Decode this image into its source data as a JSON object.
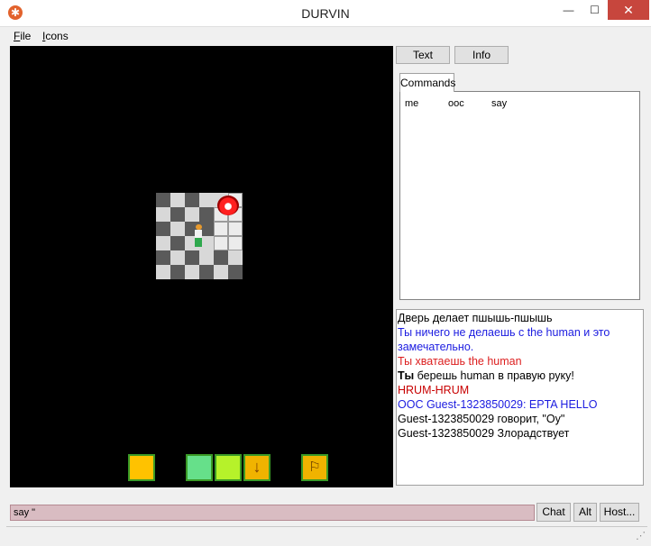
{
  "window": {
    "title": "DURVIN",
    "app_icon_glyph": "✱",
    "minimize_glyph": "—",
    "maximize_glyph": "☐",
    "close_glyph": "✕"
  },
  "menu": {
    "file": {
      "mnemonic": "F",
      "rest": "ile"
    },
    "icons": {
      "mnemonic": "I",
      "rest": "cons"
    }
  },
  "map": {
    "background": "#000000",
    "floor_grid": [
      "dldlfw",
      "ldldww",
      "dlddww",
      "ldlhww",
      "dldldl",
      "ldldld"
    ],
    "objects": [
      "fire-icon",
      "human-sprite"
    ]
  },
  "hud": {
    "slots": [
      {
        "icon": "hand-slot-icon",
        "color": "#ffc200",
        "glyph": ""
      },
      {
        "icon": "intent-help-icon",
        "color": "#66e08a",
        "glyph": ""
      },
      {
        "icon": "intent-grab-icon",
        "color": "#b6f22a",
        "glyph": ""
      },
      {
        "icon": "drop-arrow-icon",
        "color": "#f0b300",
        "glyph": "↓"
      },
      {
        "icon": "walk-run-icon",
        "color": "#f0b300",
        "glyph": "⚐"
      }
    ]
  },
  "right_panel": {
    "tabs": {
      "text": "Text",
      "info": "Info"
    },
    "commands_tab": "Commands",
    "commands": [
      "me",
      "ooc",
      "say"
    ]
  },
  "log": [
    {
      "style": "black",
      "text": "Дверь делает пшышь-пшышь"
    },
    {
      "style": "blue",
      "text": "Ты ничего не делаешь с the human и это замечательно."
    },
    {
      "style": "red",
      "text": "Ты хватаешь the human"
    },
    {
      "style": "black-bold-prefix",
      "bold": "Ты",
      "text": " берешь human в правую руку!"
    },
    {
      "style": "darkred",
      "text": "HRUM-HRUM"
    },
    {
      "style": "blue",
      "text": "OOC Guest-1323850029: EPTA HELLO"
    },
    {
      "style": "black",
      "text": "Guest-1323850029 говорит, \"Оу\""
    },
    {
      "style": "black",
      "text": "Guest-1323850029 Злорадствует"
    }
  ],
  "input": {
    "value": "say \""
  },
  "buttons": {
    "chat": "Chat",
    "alt": "Alt",
    "host": "Host..."
  },
  "statusbar": {
    "grip_glyph": "⋰"
  },
  "colors": {
    "close_button": "#c7463d",
    "input_background": "#d9bcc2",
    "log_blue": "#1c1ce0",
    "log_red": "#dc1e1e"
  }
}
